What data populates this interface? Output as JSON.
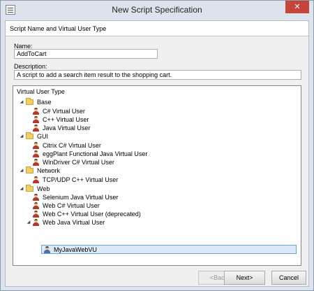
{
  "window": {
    "title": "New Script Specification",
    "close_glyph": "✕"
  },
  "header": {
    "section_title": "Script Name and Virtual User Type"
  },
  "form": {
    "name_label": "Name:",
    "name_value": "AddToCart",
    "description_label": "Description:",
    "description_value": "A script to add a search item result to the shopping cart."
  },
  "tree": {
    "header": "Virtual User Type",
    "base": {
      "label": "Base",
      "items": [
        "C# Virtual User",
        "C++ Virtual User",
        "Java Virtual User"
      ]
    },
    "gui": {
      "label": "GUI",
      "items": [
        "Citrix C# Virtual User",
        "eggPlant Functional Java Virtual User",
        "WinDriver C# Virtual User"
      ]
    },
    "network": {
      "label": "Network",
      "items": [
        "TCP/UDP C++ Virtual User"
      ]
    },
    "web": {
      "label": "Web",
      "items": [
        "Selenium Java Virtual User",
        "Web C# Virtual User",
        "Web C++ Virtual User (deprecated)",
        "Web Java Virtual User"
      ],
      "child_label": "MyJavaWebVU"
    },
    "expanded_glyph": "◢"
  },
  "buttons": {
    "back": "<Back",
    "next": "Next>",
    "cancel": "Cancel"
  },
  "colors": {
    "selection": "#dbe9f8",
    "close": "#c7443a"
  }
}
